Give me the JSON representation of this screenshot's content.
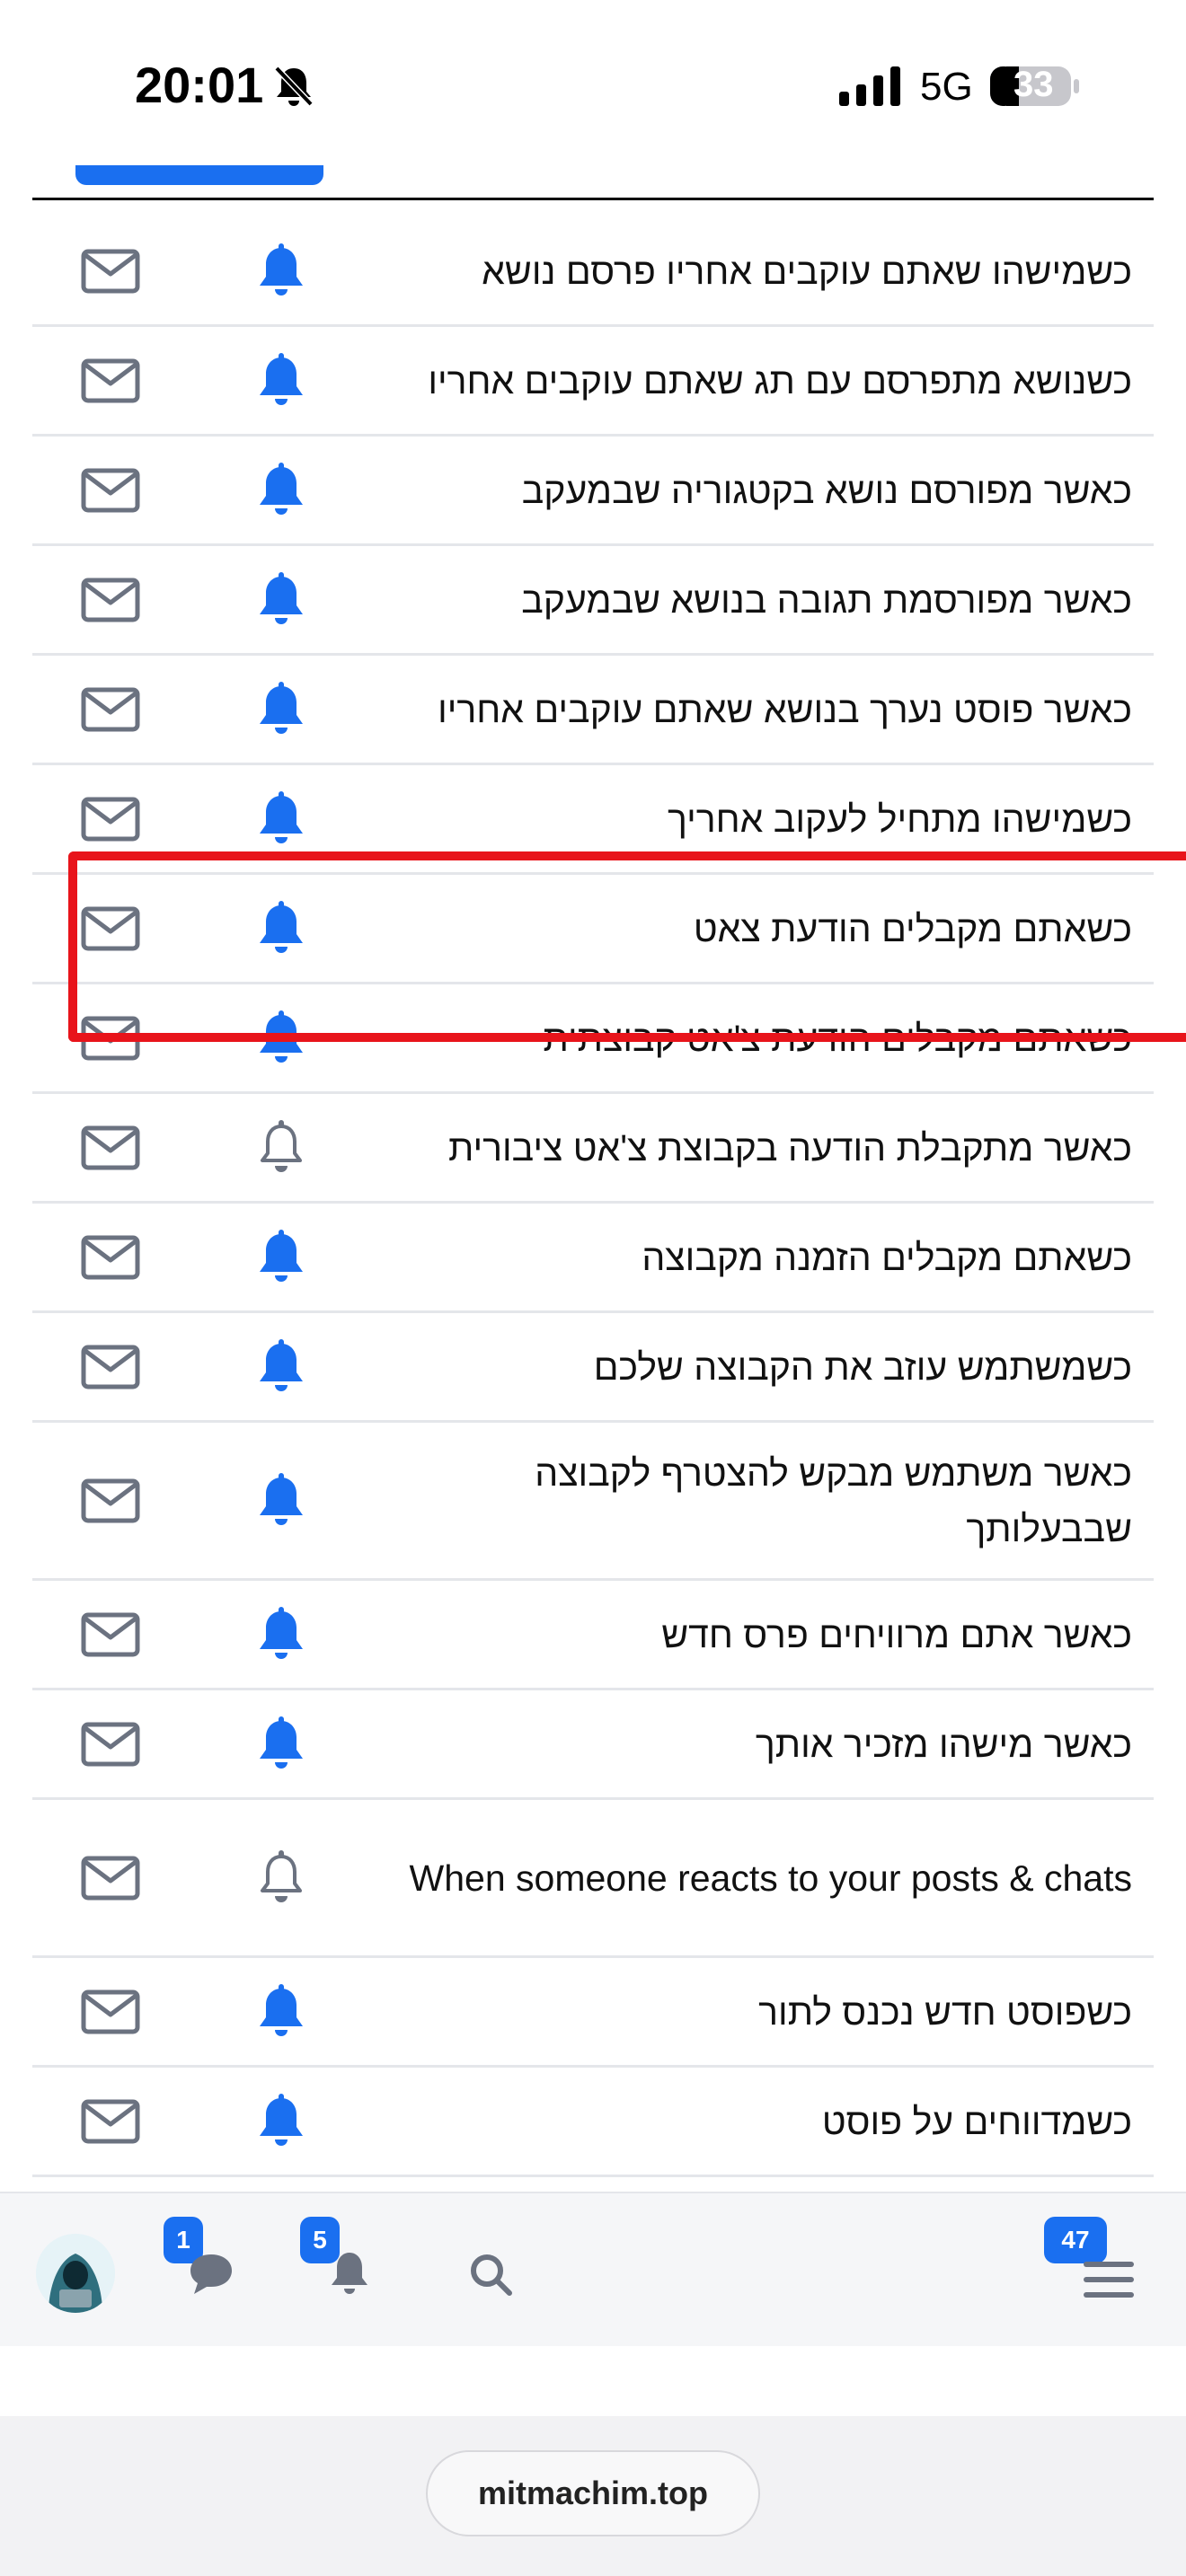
{
  "status_bar": {
    "time": "20:01",
    "network": "5G",
    "battery": "33"
  },
  "settings_rows": [
    {
      "label": "כשמישהו שאתם עוקבים אחריו פרסם נושא",
      "bell_active": true
    },
    {
      "label": "כשנושא מתפרסם עם תג שאתם עוקבים אחריו",
      "bell_active": true
    },
    {
      "label": "כאשר מפורסם נושא בקטגוריה שבמעקב",
      "bell_active": true
    },
    {
      "label": "כאשר מפורסמת תגובה בנושא שבמעקב",
      "bell_active": true
    },
    {
      "label": "כאשר פוסט נערך בנושא שאתם עוקבים אחריו",
      "bell_active": true
    },
    {
      "label": "כשמישהו מתחיל לעקוב אחריך",
      "bell_active": true
    },
    {
      "label": "כשאתם מקבלים הודעת צאט",
      "bell_active": true
    },
    {
      "label": "כשאתם מקבלים הודעת צ'אט קבוצתית",
      "bell_active": true
    },
    {
      "label": "כאשר מתקבלת הודעה בקבוצת צ'אט ציבורית",
      "bell_active": false
    },
    {
      "label": "כשאתם מקבלים הזמנה מקבוצה",
      "bell_active": true
    },
    {
      "label": "כשמשתמש עוזב את הקבוצה שלכם",
      "bell_active": true
    },
    {
      "label": "כאשר משתמש מבקש להצטרף לקבוצה שבבעלותך",
      "bell_active": true
    },
    {
      "label": "כאשר אתם מרוויחים פרס חדש",
      "bell_active": true
    },
    {
      "label": "כאשר מישהו מזכיר אותך",
      "bell_active": true
    },
    {
      "label": "When someone reacts to your posts & chats",
      "bell_active": false
    },
    {
      "label": "כשפוסט חדש נכנס לתור",
      "bell_active": true
    },
    {
      "label": "כשמדווחים על פוסט",
      "bell_active": true
    }
  ],
  "bottom_nav": {
    "chat_badge": "1",
    "notifications_badge": "5",
    "menu_badge": "47"
  },
  "browser": {
    "url": "mitmachim.top"
  },
  "colors": {
    "accent": "#1a6ff0",
    "inactive_icon": "#6b7280",
    "highlight": "#e8141b"
  }
}
